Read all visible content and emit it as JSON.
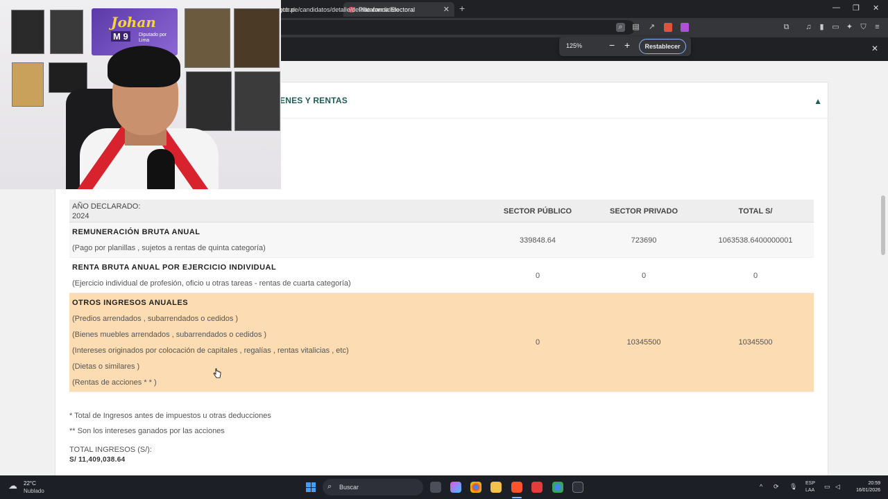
{
  "browser": {
    "tabs": [
      {
        "label": "ctoral"
      },
      {
        "label": "Plataforma Electoral"
      }
    ],
    "url": "gob.pe/candidatos/detalle/detalle-candidato",
    "zoom": {
      "level": "125%",
      "minus": "−",
      "plus": "+",
      "reset_label": "Restablecer"
    }
  },
  "section": {
    "title": "ENES Y RENTAS"
  },
  "incomes": {
    "year_label": "AÑO DECLARADO:",
    "year_value": "2024",
    "headers": {
      "public": "SECTOR PÚBLICO",
      "private": "SECTOR PRIVADO",
      "total": "TOTAL S/"
    },
    "rows": [
      {
        "title": "REMUNERACIÓN BRUTA ANUAL",
        "subs": [
          "(Pago por planillas , sujetos a rentas de quinta categoría)"
        ],
        "public": "339848.64",
        "private": "723690",
        "total": "1063538.6400000001"
      },
      {
        "title": "RENTA BRUTA ANUAL POR EJERCICIO INDIVIDUAL",
        "subs": [
          "(Ejercicio individual de profesión, oficio u otras tareas - rentas de cuarta categoría)"
        ],
        "public": "0",
        "private": "0",
        "total": "0"
      },
      {
        "title": "OTROS INGRESOS ANUALES",
        "subs": [
          "(Predios arrendados , subarrendados o cedidos )",
          "(Bienes muebles arrendados , subarrendados o cedidos )",
          "(Intereses originados por colocación de capitales , regalías , rentas vitalicias , etc)",
          "(Dietas o similares )",
          "(Rentas de acciones * * )"
        ],
        "public": "0",
        "private": "10345500",
        "total": "10345500"
      }
    ],
    "notes": [
      "* Total de Ingresos antes de impuestos u otras deducciones",
      "** Son los intereses ganados por las acciones"
    ],
    "total_label": "TOTAL INGRESOS (S/):",
    "total_value": "S/ 11,409,038.64"
  },
  "webcam": {
    "banner_name": "Johan",
    "banner_badge": "M 9",
    "banner_text": "Diputado por Lima"
  },
  "taskbar": {
    "weather_temp": "22°C",
    "weather_cond": "Nublado",
    "search_placeholder": "Buscar",
    "lang_line1": "ESP",
    "lang_line2": "LAA",
    "time": "20:59",
    "date": "16/01/2026"
  }
}
